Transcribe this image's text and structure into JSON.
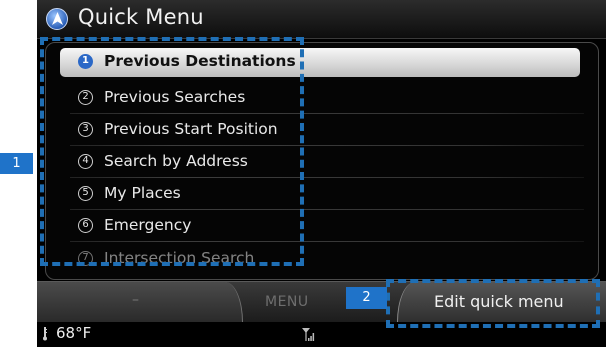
{
  "header": {
    "title": "Quick Menu",
    "icon": "navigation-compass-icon"
  },
  "menu": {
    "items": [
      {
        "number": "1",
        "label": "Previous Destinations"
      },
      {
        "number": "2",
        "label": "Previous Searches"
      },
      {
        "number": "3",
        "label": "Previous Start Position"
      },
      {
        "number": "4",
        "label": "Search by Address"
      },
      {
        "number": "5",
        "label": "My Places"
      },
      {
        "number": "6",
        "label": "Emergency"
      },
      {
        "number": "7",
        "label": "Intersection Search"
      }
    ],
    "selected_index": 0
  },
  "softkeys": {
    "left": "–",
    "middle": "MENU",
    "right": "Edit quick menu"
  },
  "status": {
    "temperature": "68°F",
    "icons": [
      "thermometer-icon",
      "signal-strength-icon"
    ]
  },
  "callouts": {
    "one": "1",
    "two": "2"
  },
  "colors": {
    "accent": "#2b68c7",
    "callout": "#1f73c9"
  }
}
